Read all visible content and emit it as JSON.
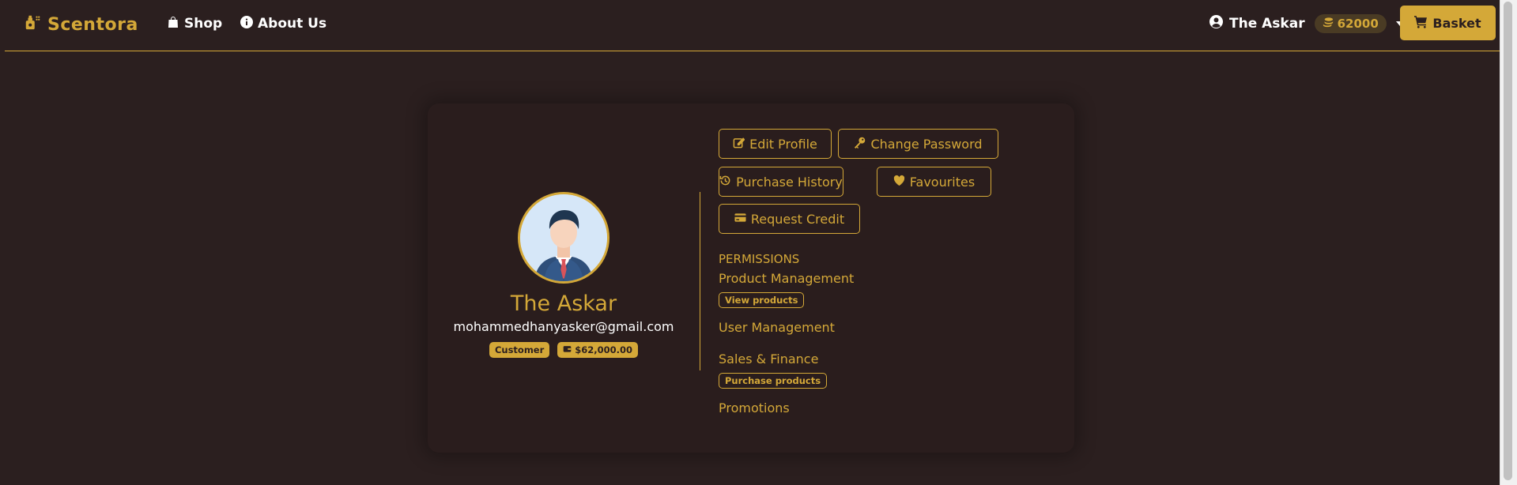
{
  "colors": {
    "accent": "#d4a838",
    "background": "#2b1f1f",
    "card": "#2a1d1d"
  },
  "navbar": {
    "brand": "Scentora",
    "links": [
      {
        "label": "Shop",
        "icon": "bag-icon"
      },
      {
        "label": "About Us",
        "icon": "info-circle-icon"
      }
    ],
    "user_name": "The Askar",
    "balance": "62000",
    "basket_label": "Basket"
  },
  "profile": {
    "name": "The Askar",
    "email": "mohammedhanyasker@gmail.com",
    "role_badge": "Customer",
    "wallet_badge": "$62,000.00"
  },
  "actions": {
    "edit_profile": "Edit Profile",
    "change_password": "Change Password",
    "purchase_history": "Purchase History",
    "favourites": "Favourites",
    "request_credit": "Request Credit"
  },
  "permissions": {
    "heading": "PERMISSIONS",
    "groups": [
      {
        "title": "Product Management",
        "chips": [
          "View products"
        ]
      },
      {
        "title": "User Management",
        "chips": []
      },
      {
        "title": "Sales & Finance",
        "chips": [
          "Purchase products"
        ]
      },
      {
        "title": "Promotions",
        "chips": []
      }
    ]
  }
}
